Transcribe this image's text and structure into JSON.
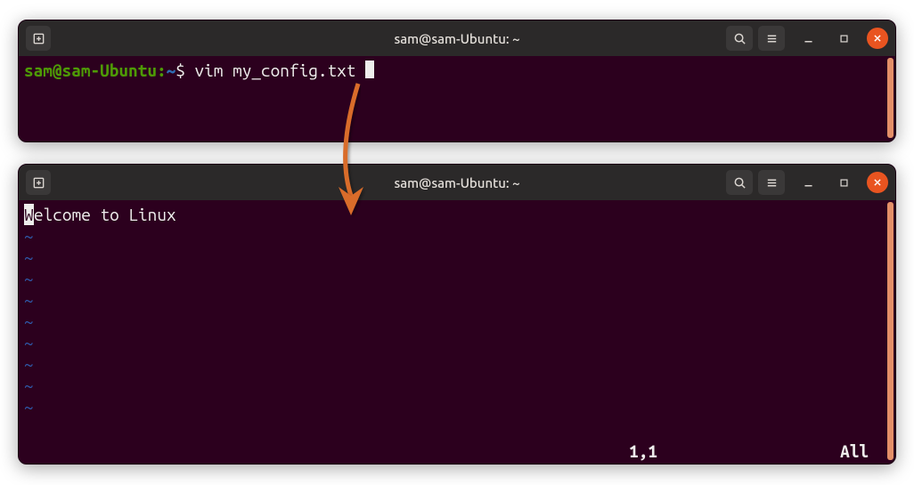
{
  "window1": {
    "title": "sam@sam-Ubuntu: ~",
    "prompt_userhost": "sam@sam-Ubuntu",
    "prompt_colon": ":",
    "prompt_path": "~",
    "prompt_dollar": "$",
    "command": "vim my_config.txt"
  },
  "window2": {
    "title": "sam@sam-Ubuntu: ~",
    "file_content_first_char": "W",
    "file_content_rest": "elcome to Linux",
    "tilde": "~",
    "status_position": "1,1",
    "status_scroll": "All"
  }
}
